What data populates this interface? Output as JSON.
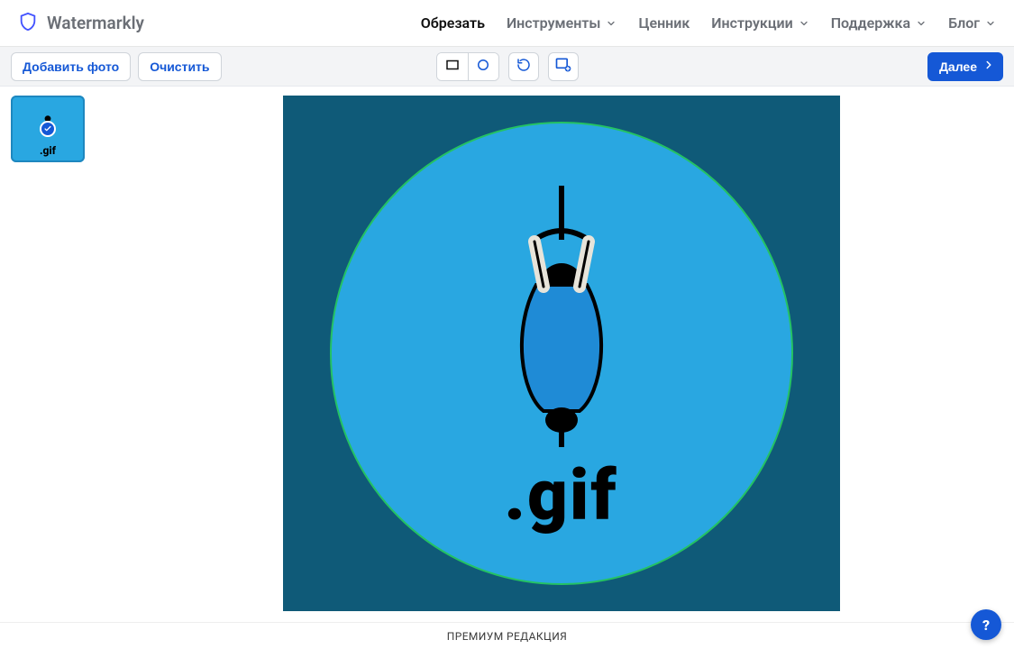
{
  "brand": {
    "name": "Watermarkly"
  },
  "nav": {
    "crop": "Обрезать",
    "tools": "Инструменты",
    "pricing": "Ценник",
    "instructions": "Инструкции",
    "support": "Поддержка",
    "blog": "Блог"
  },
  "toolbar": {
    "add_photo": "Добавить фото",
    "clear": "Очистить",
    "next": "Далее"
  },
  "thumbnail": {
    "label": ".gif"
  },
  "canvas": {
    "label": ".gif"
  },
  "footer": {
    "premium": "ПРЕМИУМ РЕДАКЦИЯ"
  },
  "help": {
    "label": "?"
  }
}
